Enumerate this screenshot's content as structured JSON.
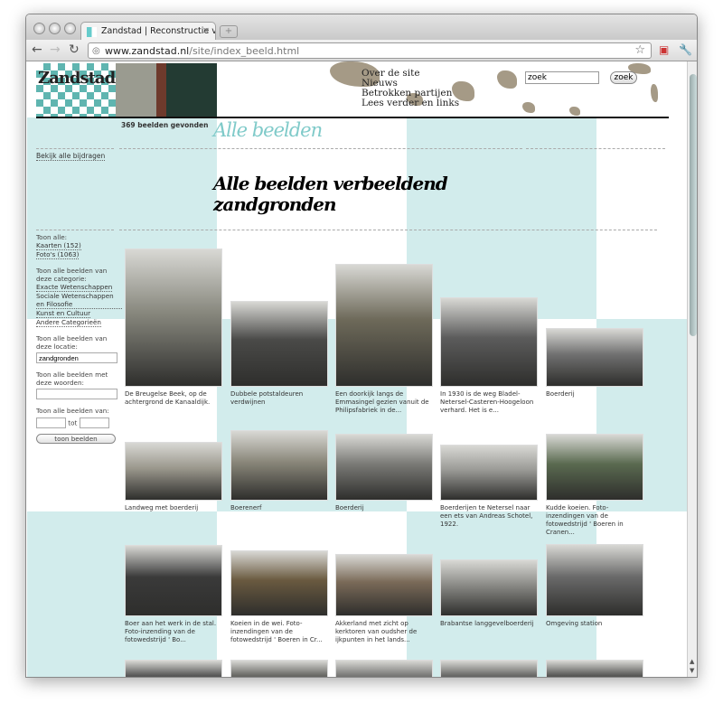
{
  "browser": {
    "tab_title": "Zandstad | Reconstructie van",
    "url_domain": "www.zandstad.nl",
    "url_path": "/site/index_beeld.html"
  },
  "header": {
    "logo": "Zandstad",
    "menu": [
      "Over de site",
      "Nieuws",
      "Betrokken partijen",
      "Lees verder en links"
    ],
    "search_value": "zoek",
    "search_button": "zoek"
  },
  "result_count": "369 beelden gevonden",
  "page_title": "Alle beelden",
  "heading": "Alle beelden verbeeldend zandgronden",
  "sidebar": {
    "all_contributions": "Bekijk alle bijdragen",
    "show_all": "Toon alle:",
    "types": [
      "Kaarten (152)",
      "Foto's (1063)"
    ],
    "category_label": "Toon alle beelden van deze categorie:",
    "categories": [
      "Exacte Wetenschappen",
      "Sociale Wetenschappen en Filosofie",
      "Kunst en Cultuur",
      "Andere Categorieën"
    ],
    "location_label": "Toon alle beelden van deze locatie:",
    "location_value": "zandgronden",
    "words_label": "Toon alle beelden met deze woorden:",
    "words_value": "",
    "period_label": "Toon alle beelden van:",
    "period_to": "tot",
    "submit": "toon beelden"
  },
  "colors": {
    "accent": "#7fcac9",
    "stripe": "#d2ecec"
  },
  "items": [
    {
      "caption": "De Breugelse Beek, op de achtergrond de Kanaaldijk."
    },
    {
      "caption": "Dubbele potstaldeuren verdwijnen"
    },
    {
      "caption": "Een doorkijk langs de Emmasingel gezien vanuit de Philipsfabriek in de..."
    },
    {
      "caption": "In 1930 is de weg Bladel-Netersel-Casteren-Hoogeloon verhard. Het is e..."
    },
    {
      "caption": "Boerderij"
    },
    {
      "caption": "Landweg met boerderij"
    },
    {
      "caption": "Boerenerf"
    },
    {
      "caption": "Boerderij"
    },
    {
      "caption": "Boerderijen te Netersel naar een ets van Andreas Schotel, 1922."
    },
    {
      "caption": "Kudde koeien. Foto-inzendingen van de fotowedstrijd ' Boeren in Cranen..."
    },
    {
      "caption": "Boer aan het werk in de stal. Foto-inzending van de fotowedstrijd ' Bo..."
    },
    {
      "caption": "Koeien in de wei. Foto-inzendingen van de fotowedstrijd ' Boeren in Cr..."
    },
    {
      "caption": "Akkerland met zicht op kerktoren van oudsher de ijkpunten in het lands..."
    },
    {
      "caption": "Brabantse langgevelboerderij"
    },
    {
      "caption": "Omgeving station"
    },
    {
      "caption": ""
    },
    {
      "caption": ""
    },
    {
      "caption": ""
    },
    {
      "caption": ""
    },
    {
      "caption": ""
    }
  ]
}
